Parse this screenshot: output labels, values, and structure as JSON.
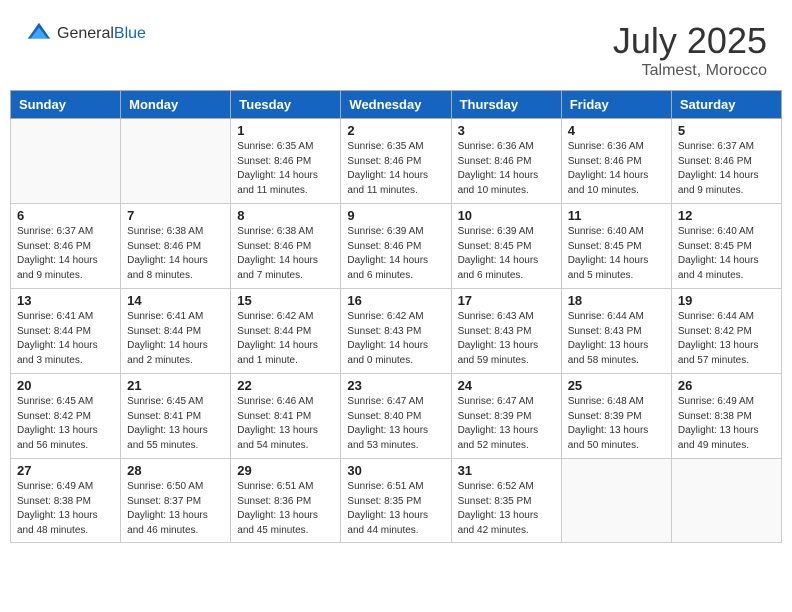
{
  "header": {
    "logo_general": "General",
    "logo_blue": "Blue",
    "month": "July 2025",
    "location": "Talmest, Morocco"
  },
  "weekdays": [
    "Sunday",
    "Monday",
    "Tuesday",
    "Wednesday",
    "Thursday",
    "Friday",
    "Saturday"
  ],
  "weeks": [
    [
      {
        "day": "",
        "sunrise": "",
        "sunset": "",
        "daylight": ""
      },
      {
        "day": "",
        "sunrise": "",
        "sunset": "",
        "daylight": ""
      },
      {
        "day": "1",
        "sunrise": "Sunrise: 6:35 AM",
        "sunset": "Sunset: 8:46 PM",
        "daylight": "Daylight: 14 hours and 11 minutes."
      },
      {
        "day": "2",
        "sunrise": "Sunrise: 6:35 AM",
        "sunset": "Sunset: 8:46 PM",
        "daylight": "Daylight: 14 hours and 11 minutes."
      },
      {
        "day": "3",
        "sunrise": "Sunrise: 6:36 AM",
        "sunset": "Sunset: 8:46 PM",
        "daylight": "Daylight: 14 hours and 10 minutes."
      },
      {
        "day": "4",
        "sunrise": "Sunrise: 6:36 AM",
        "sunset": "Sunset: 8:46 PM",
        "daylight": "Daylight: 14 hours and 10 minutes."
      },
      {
        "day": "5",
        "sunrise": "Sunrise: 6:37 AM",
        "sunset": "Sunset: 8:46 PM",
        "daylight": "Daylight: 14 hours and 9 minutes."
      }
    ],
    [
      {
        "day": "6",
        "sunrise": "Sunrise: 6:37 AM",
        "sunset": "Sunset: 8:46 PM",
        "daylight": "Daylight: 14 hours and 9 minutes."
      },
      {
        "day": "7",
        "sunrise": "Sunrise: 6:38 AM",
        "sunset": "Sunset: 8:46 PM",
        "daylight": "Daylight: 14 hours and 8 minutes."
      },
      {
        "day": "8",
        "sunrise": "Sunrise: 6:38 AM",
        "sunset": "Sunset: 8:46 PM",
        "daylight": "Daylight: 14 hours and 7 minutes."
      },
      {
        "day": "9",
        "sunrise": "Sunrise: 6:39 AM",
        "sunset": "Sunset: 8:46 PM",
        "daylight": "Daylight: 14 hours and 6 minutes."
      },
      {
        "day": "10",
        "sunrise": "Sunrise: 6:39 AM",
        "sunset": "Sunset: 8:45 PM",
        "daylight": "Daylight: 14 hours and 6 minutes."
      },
      {
        "day": "11",
        "sunrise": "Sunrise: 6:40 AM",
        "sunset": "Sunset: 8:45 PM",
        "daylight": "Daylight: 14 hours and 5 minutes."
      },
      {
        "day": "12",
        "sunrise": "Sunrise: 6:40 AM",
        "sunset": "Sunset: 8:45 PM",
        "daylight": "Daylight: 14 hours and 4 minutes."
      }
    ],
    [
      {
        "day": "13",
        "sunrise": "Sunrise: 6:41 AM",
        "sunset": "Sunset: 8:44 PM",
        "daylight": "Daylight: 14 hours and 3 minutes."
      },
      {
        "day": "14",
        "sunrise": "Sunrise: 6:41 AM",
        "sunset": "Sunset: 8:44 PM",
        "daylight": "Daylight: 14 hours and 2 minutes."
      },
      {
        "day": "15",
        "sunrise": "Sunrise: 6:42 AM",
        "sunset": "Sunset: 8:44 PM",
        "daylight": "Daylight: 14 hours and 1 minute."
      },
      {
        "day": "16",
        "sunrise": "Sunrise: 6:42 AM",
        "sunset": "Sunset: 8:43 PM",
        "daylight": "Daylight: 14 hours and 0 minutes."
      },
      {
        "day": "17",
        "sunrise": "Sunrise: 6:43 AM",
        "sunset": "Sunset: 8:43 PM",
        "daylight": "Daylight: 13 hours and 59 minutes."
      },
      {
        "day": "18",
        "sunrise": "Sunrise: 6:44 AM",
        "sunset": "Sunset: 8:43 PM",
        "daylight": "Daylight: 13 hours and 58 minutes."
      },
      {
        "day": "19",
        "sunrise": "Sunrise: 6:44 AM",
        "sunset": "Sunset: 8:42 PM",
        "daylight": "Daylight: 13 hours and 57 minutes."
      }
    ],
    [
      {
        "day": "20",
        "sunrise": "Sunrise: 6:45 AM",
        "sunset": "Sunset: 8:42 PM",
        "daylight": "Daylight: 13 hours and 56 minutes."
      },
      {
        "day": "21",
        "sunrise": "Sunrise: 6:45 AM",
        "sunset": "Sunset: 8:41 PM",
        "daylight": "Daylight: 13 hours and 55 minutes."
      },
      {
        "day": "22",
        "sunrise": "Sunrise: 6:46 AM",
        "sunset": "Sunset: 8:41 PM",
        "daylight": "Daylight: 13 hours and 54 minutes."
      },
      {
        "day": "23",
        "sunrise": "Sunrise: 6:47 AM",
        "sunset": "Sunset: 8:40 PM",
        "daylight": "Daylight: 13 hours and 53 minutes."
      },
      {
        "day": "24",
        "sunrise": "Sunrise: 6:47 AM",
        "sunset": "Sunset: 8:39 PM",
        "daylight": "Daylight: 13 hours and 52 minutes."
      },
      {
        "day": "25",
        "sunrise": "Sunrise: 6:48 AM",
        "sunset": "Sunset: 8:39 PM",
        "daylight": "Daylight: 13 hours and 50 minutes."
      },
      {
        "day": "26",
        "sunrise": "Sunrise: 6:49 AM",
        "sunset": "Sunset: 8:38 PM",
        "daylight": "Daylight: 13 hours and 49 minutes."
      }
    ],
    [
      {
        "day": "27",
        "sunrise": "Sunrise: 6:49 AM",
        "sunset": "Sunset: 8:38 PM",
        "daylight": "Daylight: 13 hours and 48 minutes."
      },
      {
        "day": "28",
        "sunrise": "Sunrise: 6:50 AM",
        "sunset": "Sunset: 8:37 PM",
        "daylight": "Daylight: 13 hours and 46 minutes."
      },
      {
        "day": "29",
        "sunrise": "Sunrise: 6:51 AM",
        "sunset": "Sunset: 8:36 PM",
        "daylight": "Daylight: 13 hours and 45 minutes."
      },
      {
        "day": "30",
        "sunrise": "Sunrise: 6:51 AM",
        "sunset": "Sunset: 8:35 PM",
        "daylight": "Daylight: 13 hours and 44 minutes."
      },
      {
        "day": "31",
        "sunrise": "Sunrise: 6:52 AM",
        "sunset": "Sunset: 8:35 PM",
        "daylight": "Daylight: 13 hours and 42 minutes."
      },
      {
        "day": "",
        "sunrise": "",
        "sunset": "",
        "daylight": ""
      },
      {
        "day": "",
        "sunrise": "",
        "sunset": "",
        "daylight": ""
      }
    ]
  ]
}
